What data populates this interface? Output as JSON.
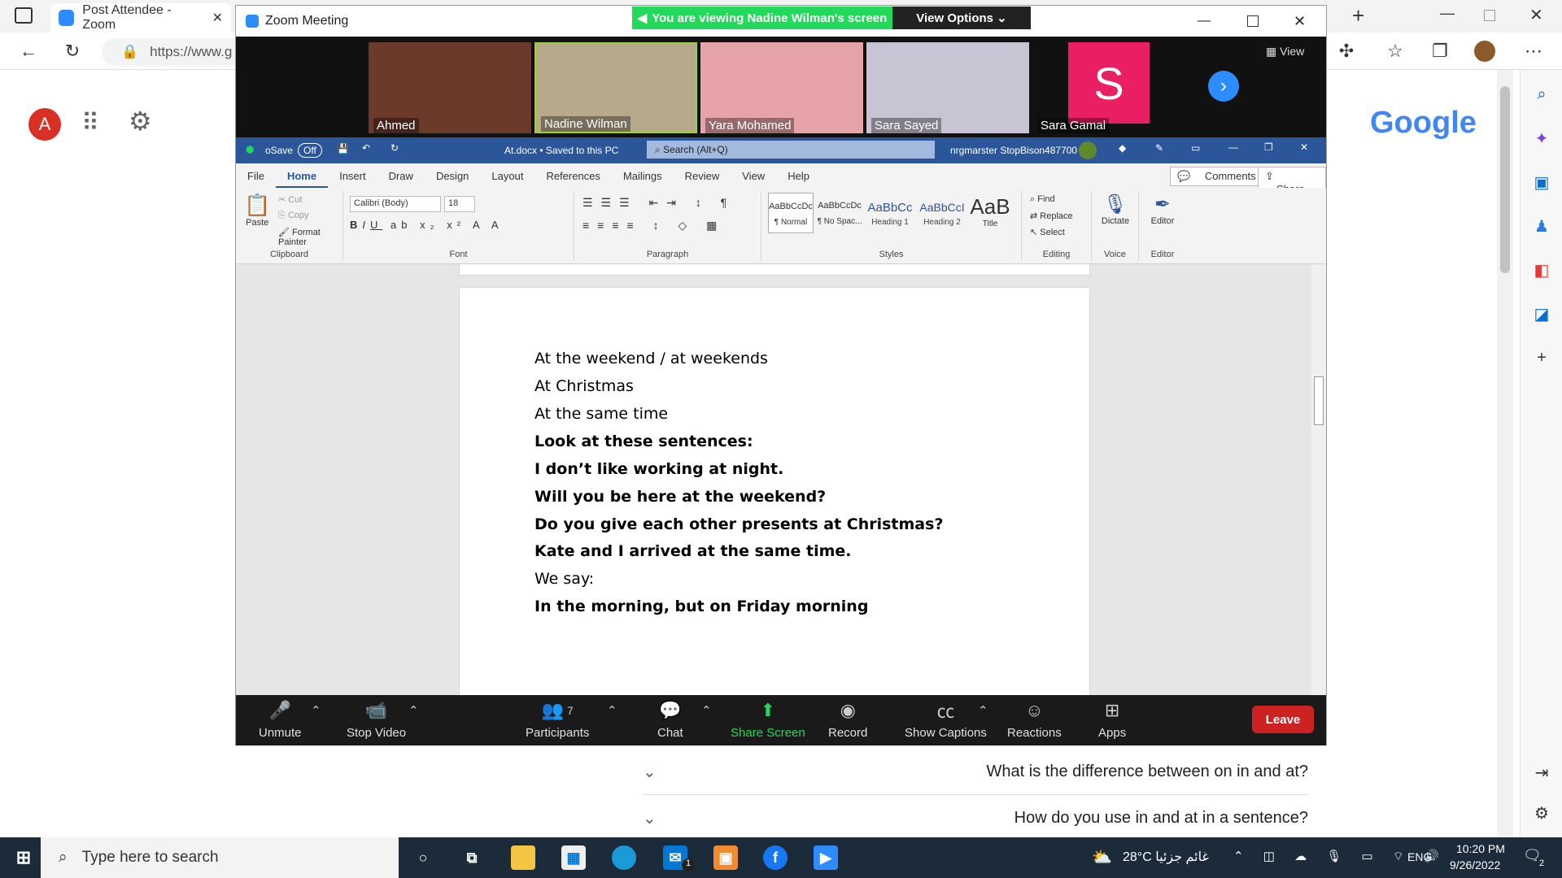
{
  "browser": {
    "tab_title": "Post Attendee - Zoom",
    "url": "https://www.g",
    "avatar_letter": "A",
    "logo": "Google"
  },
  "faq": [
    {
      "question": "What is the difference between on in and at?"
    },
    {
      "question": "How do you use in and at in a sentence?"
    }
  ],
  "zoom": {
    "window_title": "Zoom Meeting",
    "banner": "You are viewing Nadine Wilman's screen",
    "view_options": "View Options",
    "view_label": "View",
    "participants": [
      {
        "name": "Ahmed",
        "color": "#6b3a2a"
      },
      {
        "name": "Nadine Wilman",
        "color": "#b7a98c"
      },
      {
        "name": "Yara Mohamed",
        "color": "#e6a3a8"
      },
      {
        "name": "Sara Sayed",
        "color": "#c9c4d3"
      },
      {
        "name": "Sara Gamal",
        "color": "#e91e63",
        "initial": "S"
      }
    ],
    "controls": {
      "unmute": "Unmute",
      "stop_video": "Stop Video",
      "participants": "Participants",
      "participants_count": "7",
      "chat": "Chat",
      "share_screen": "Share Screen",
      "record": "Record",
      "show_captions": "Show Captions",
      "reactions": "Reactions",
      "apps": "Apps",
      "leave": "Leave"
    }
  },
  "word": {
    "autosave": "oSave",
    "autosave_state": "Off",
    "doc_title": "At.docx • Saved to this PC",
    "search": "Search (Alt+Q)",
    "user": "nrgmarster StopBison487700",
    "tabs": [
      "File",
      "Home",
      "Insert",
      "Draw",
      "Design",
      "Layout",
      "References",
      "Mailings",
      "Review",
      "View",
      "Help"
    ],
    "comments": "Comments",
    "share": "Share",
    "ribbon": {
      "paste": "Paste",
      "cut": "Cut",
      "copy": "Copy",
      "format_painter": "Format Painter",
      "clipboard": "Clipboard",
      "font_name": "Calibri (Body)",
      "font_size": "18",
      "font": "Font",
      "paragraph": "Paragraph",
      "styles": "Styles",
      "style_items": [
        {
          "preview": "AaBbCcDc",
          "label": "¶ Normal"
        },
        {
          "preview": "AaBbCcDc",
          "label": "¶ No Spac..."
        },
        {
          "preview": "AaBbCc",
          "label": "Heading 1"
        },
        {
          "preview": "AaBbCcI",
          "label": "Heading 2"
        },
        {
          "preview": "AaB",
          "label": "Title"
        }
      ],
      "find": "Find",
      "replace": "Replace",
      "select": "Select",
      "editing": "Editing",
      "dictate": "Dictate",
      "voice": "Voice",
      "editor": "Editor",
      "editor_group": "Editor"
    },
    "lines": [
      {
        "text": "At the weekend / at weekends",
        "bold": false
      },
      {
        "text": "At Christmas",
        "bold": false
      },
      {
        "text": "At the same time",
        "bold": false
      },
      {
        "text": "Look at these sentences:",
        "bold": true
      },
      {
        "text": "I don’t like working at night.",
        "bold": true
      },
      {
        "text": "Will you be here at the weekend?",
        "bold": true
      },
      {
        "text": "Do you give each other presents at Christmas?",
        "bold": true
      },
      {
        "text": "Kate and I arrived at the same time.",
        "bold": true
      },
      {
        "text": "We say:",
        "bold": false
      },
      {
        "text": "In the morning, but on Friday morning",
        "bold": true
      }
    ]
  },
  "taskbar": {
    "search_placeholder": "Type here to search",
    "weather": "28°C غائم جزئيا",
    "language": "ENG",
    "time": "10:20 PM",
    "date": "9/26/2022",
    "mail_badge": "1",
    "notif_count": "2"
  }
}
